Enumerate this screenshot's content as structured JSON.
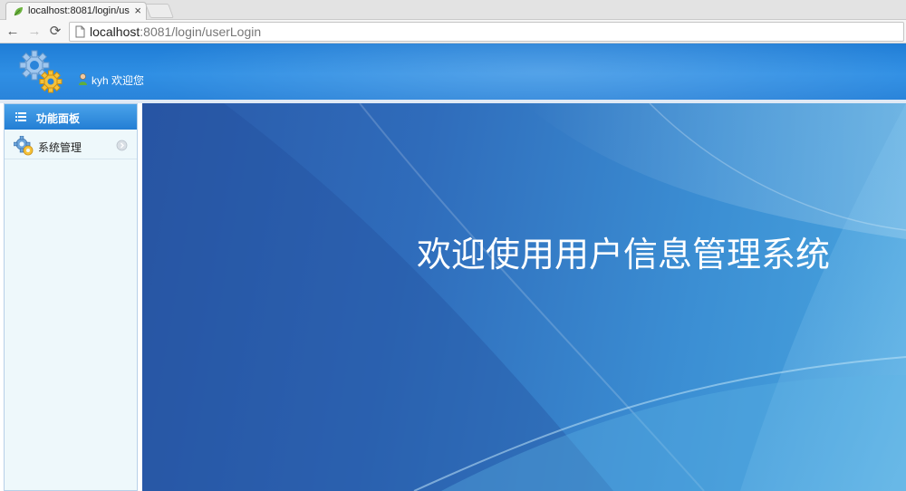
{
  "browser": {
    "tab_title": "localhost:8081/login/us",
    "tab_close": "×",
    "url_host": "localhost",
    "url_rest": ":8081/login/userLogin",
    "nav_back": "←",
    "nav_forward": "→",
    "nav_reload": "⟳"
  },
  "header": {
    "welcome_text": "kyh 欢迎您"
  },
  "sidebar": {
    "panel_title": "功能面板",
    "items": [
      {
        "label": "系统管理",
        "icon": "gear-icon"
      }
    ]
  },
  "main": {
    "headline": "欢迎使用用户信息管理系统"
  },
  "colors": {
    "header_blue": "#2a84da",
    "panel_blue": "#237ed4",
    "sidebar_bg": "#eef8fb",
    "main_bg_dark": "#2a59a8",
    "main_bg_light": "#4aa6df"
  }
}
